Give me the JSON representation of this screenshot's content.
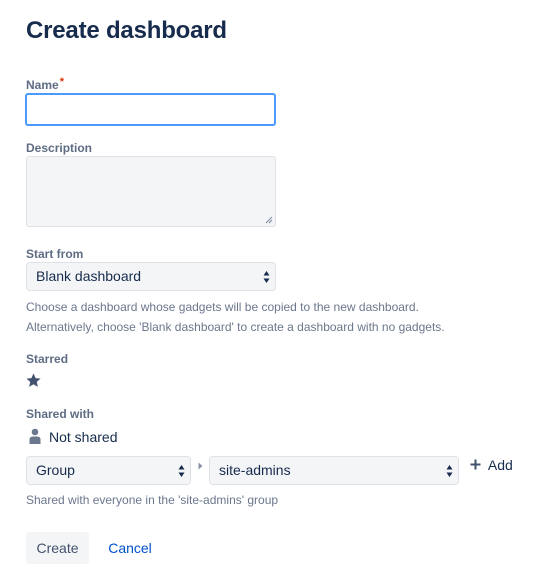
{
  "page": {
    "title": "Create dashboard"
  },
  "form": {
    "name": {
      "label": "Name",
      "required_mark": "*",
      "value": ""
    },
    "description": {
      "label": "Description",
      "value": ""
    },
    "start_from": {
      "label": "Start from",
      "selected": "Blank dashboard",
      "help_line1": "Choose a dashboard whose gadgets will be copied to the new dashboard.",
      "help_line2": "Alternatively, choose 'Blank dashboard' to create a dashboard with no gadgets."
    },
    "starred": {
      "label": "Starred",
      "icon": "star-icon"
    },
    "shared_with": {
      "label": "Shared with",
      "current": "Not shared",
      "current_icon": "person-icon",
      "type_selected": "Group",
      "group_selected": "site-admins",
      "add_label": "Add",
      "help": "Shared with everyone in the 'site-admins' group"
    }
  },
  "actions": {
    "create_label": "Create",
    "cancel_label": "Cancel"
  },
  "colors": {
    "accent": "#0052cc",
    "focus": "#4c9aff",
    "required": "#de350b",
    "field_bg": "#f4f5f7"
  }
}
